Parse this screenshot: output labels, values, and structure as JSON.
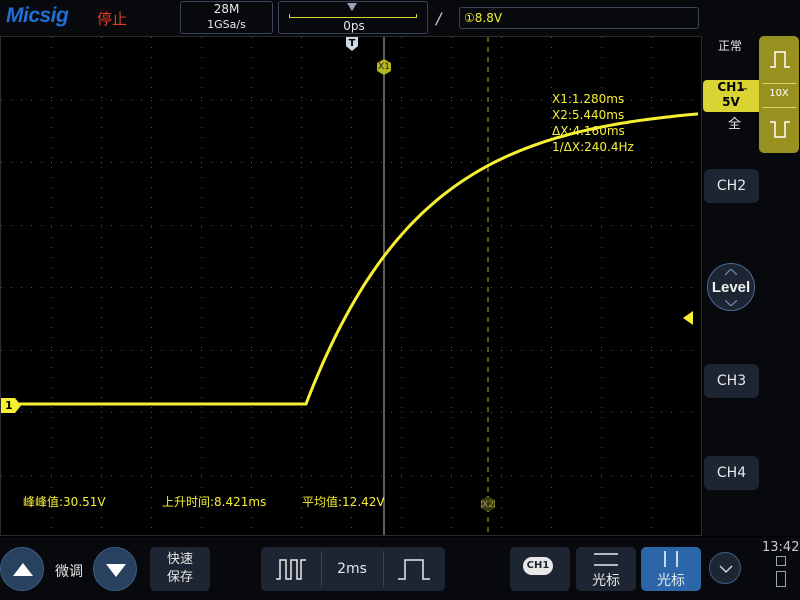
{
  "top": {
    "brand": "Micsig",
    "run_state": "停止",
    "memory_depth": "28M",
    "sample_rate": "1GSa/s",
    "time_offset": "0ps",
    "trigger_edge": "∕",
    "trigger_info": "①8.8V"
  },
  "channel1": {
    "marker": "1",
    "label": "CH1",
    "coupling": "⎓",
    "scale": "5V",
    "bandwidth": "全",
    "probe": "10X",
    "acq_mode": "正常"
  },
  "cursor_tags": {
    "x1": "X1",
    "x2": "X2",
    "trigger_pos": "T"
  },
  "cursors": {
    "x1": "X1:1.280ms",
    "x2": "X2:5.440ms",
    "dx": "ΔX:4.160ms",
    "inv_dx": "1/ΔX:240.4Hz"
  },
  "measurements": [
    "峰峰值:30.51V",
    "上升时间:8.421ms",
    "平均值:12.42V"
  ],
  "side": {
    "ch2": "CH2",
    "ch3": "CH3",
    "ch4": "CH4",
    "level": "Level"
  },
  "bottom": {
    "fine_adjust": "微调",
    "quick_save_line1": "快速",
    "quick_save_line2": "保存",
    "timebase": "2ms",
    "source": "CH1",
    "cursor_h": "光标",
    "cursor_v": "光标",
    "clock": "13:42"
  },
  "colors": {
    "ch1": "#f6f033",
    "brand": "#1f6fd6",
    "stop": "#e23b2e",
    "active_button": "#2b66a8",
    "button": "#1d2533"
  }
}
